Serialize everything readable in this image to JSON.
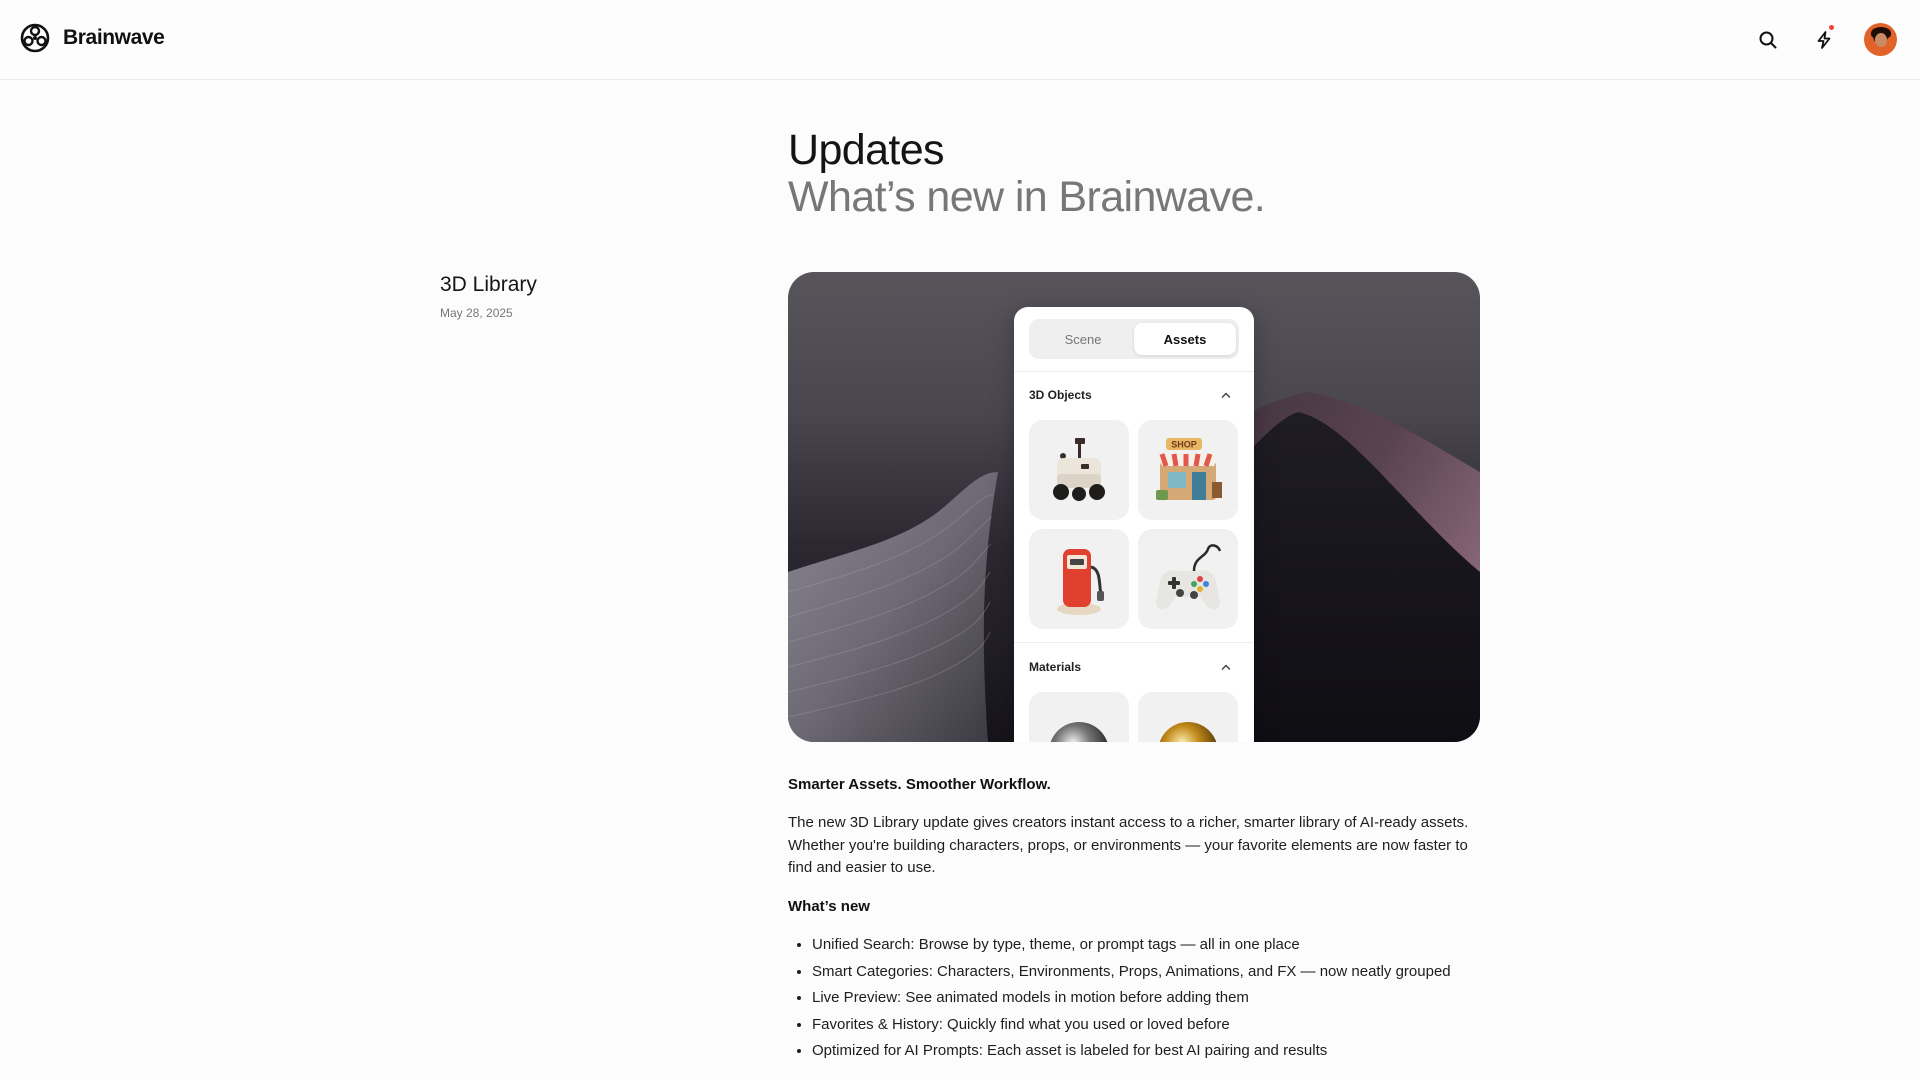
{
  "header": {
    "brand": "Brainwave",
    "icons": [
      "logo-icon",
      "search-icon",
      "bolt-icon",
      "avatar"
    ],
    "notification_color": "#f0443a"
  },
  "page": {
    "title": "Updates",
    "subtitle": "What’s new in Brainwave."
  },
  "entry": {
    "title": "3D Library",
    "date": "May 28, 2025",
    "hero": {
      "tabs": [
        "Scene",
        "Assets"
      ],
      "active_tab": "Assets",
      "sections": [
        {
          "title": "3D Objects",
          "items": [
            "robot",
            "shop",
            "gas-pump",
            "game-controller"
          ]
        },
        {
          "title": "Materials",
          "items": [
            "chrome-sphere",
            "gold-sphere"
          ]
        }
      ],
      "shop_sign": "SHOP"
    },
    "lead": "Smarter Assets. Smoother Workflow.",
    "paragraph": "The new 3D Library update gives creators instant access to a richer, smarter library of AI-ready assets. Whether you're building characters, props, or environments — your favorite elements are now faster to find and easier to use.",
    "whats_new_heading": "What’s new",
    "bullets": [
      "Unified Search: Browse by type, theme, or prompt tags — all in one place",
      "Smart Categories: Characters, Environments, Props, Animations, and FX — now neatly grouped",
      "Live Preview: See animated models in motion before adding them",
      "Favorites & History: Quickly find what you used or loved before",
      "Optimized for AI Prompts: Each asset is labeled for best AI pairing and results"
    ]
  }
}
